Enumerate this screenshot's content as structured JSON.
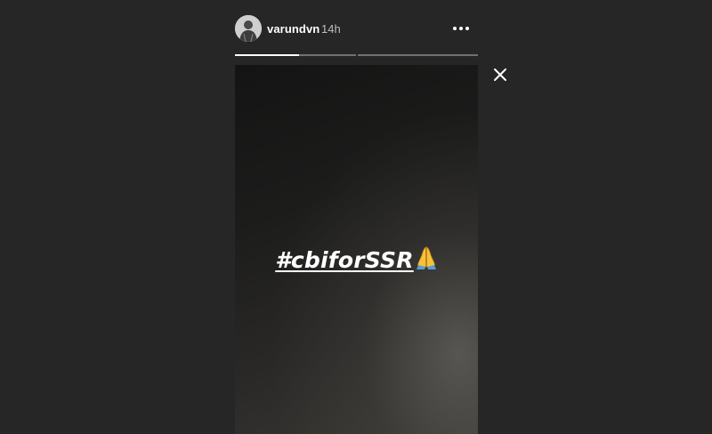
{
  "header": {
    "username": "varundvn",
    "timestamp": "14h",
    "avatar_icon": "profile-avatar-icon",
    "more_icon": "more-options-icon"
  },
  "progress": {
    "segments": [
      {
        "fill": 0.53
      },
      {
        "fill": 0
      }
    ]
  },
  "close_icon": "close-icon",
  "story": {
    "caption": "#cbiforSSR",
    "emoji_icon": "folded-hands-icon"
  }
}
